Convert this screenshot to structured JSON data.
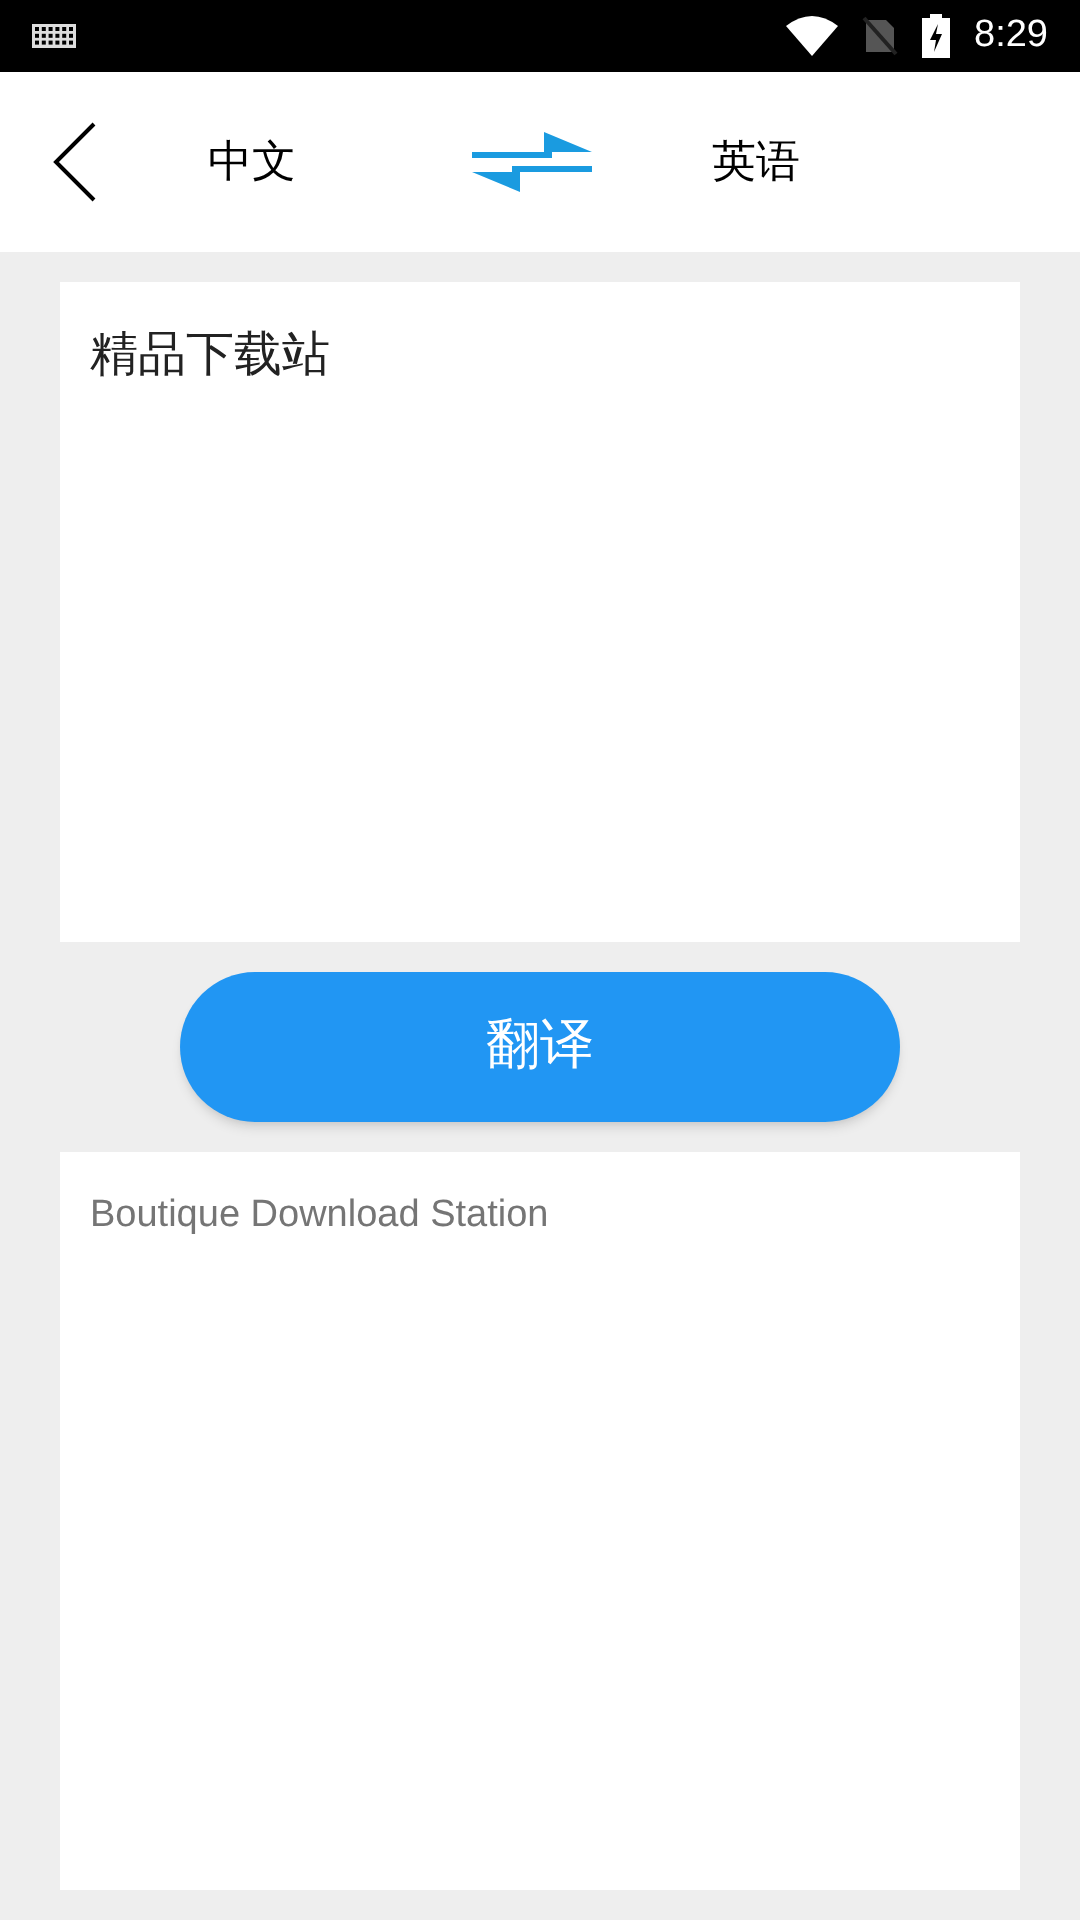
{
  "status_bar": {
    "time": "8:29"
  },
  "header": {
    "source_language": "中文",
    "target_language": "英语"
  },
  "input": {
    "value": "精品下载站"
  },
  "translate_button": {
    "label": "翻译"
  },
  "output": {
    "text": "Boutique Download Station"
  }
}
